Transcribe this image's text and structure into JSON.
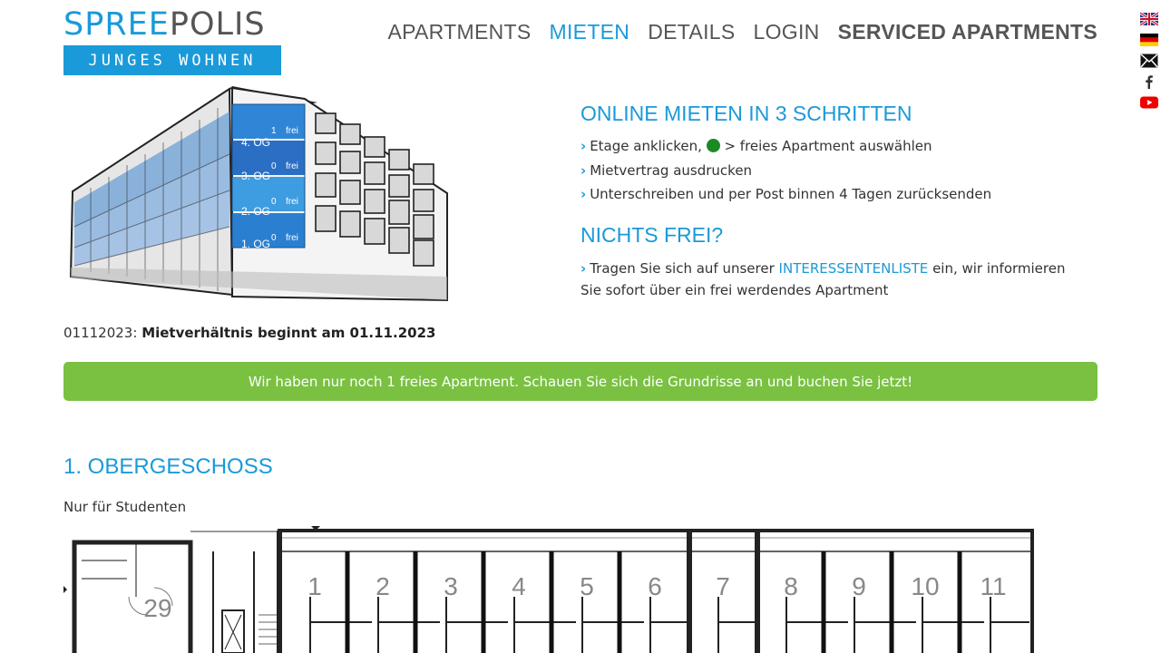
{
  "logo": {
    "word_a": "SPREE",
    "word_b": "POLIS",
    "tagline": "JUNGES WOHNEN"
  },
  "nav": [
    {
      "label": "APARTMENTS",
      "active": false,
      "bold": false
    },
    {
      "label": "MIETEN",
      "active": true,
      "bold": false
    },
    {
      "label": "DETAILS",
      "active": false,
      "bold": false
    },
    {
      "label": "LOGIN",
      "active": false,
      "bold": false
    },
    {
      "label": "SERVICED APARTMENTS",
      "active": false,
      "bold": true
    }
  ],
  "side_icons": [
    "flag-uk-icon",
    "flag-de-icon",
    "mail-icon",
    "facebook-icon",
    "youtube-icon"
  ],
  "building": {
    "floors": [
      {
        "label": "4. OG",
        "free": "1",
        "word": "frei"
      },
      {
        "label": "3. OG",
        "free": "0",
        "word": "frei"
      },
      {
        "label": "2. OG",
        "free": "0",
        "word": "frei"
      },
      {
        "label": "1. OG",
        "free": "0",
        "word": "frei"
      }
    ]
  },
  "steps": {
    "title": "ONLINE MIETEN IN 3 SCHRITTEN",
    "step1_a": "Etage anklicken,",
    "step1_b": "> freies Apartment auswählen",
    "step2": "Mietvertrag ausdrucken",
    "step3": "Unterschreiben und per Post binnen 4 Tagen zurücksenden",
    "nothing_title": "NICHTS FREI?",
    "interest_a": "Tragen Sie sich auf unserer",
    "interest_link": "INTERESSENTENLISTE",
    "interest_b": "ein, wir informieren Sie sofort über ein frei werdendes Apartment"
  },
  "notice": {
    "code": "01112023:",
    "text": "Mietverhältnis beginnt am 01.11.2023"
  },
  "banner": "Wir haben nur noch 1 freies Apartment. Schauen Sie sich die Grundrisse an und buchen Sie jetzt!",
  "floor": {
    "title": "1. OBERGESCHOSS",
    "subtitle": "Nur für Studenten",
    "units": [
      "1",
      "2",
      "3",
      "4",
      "5",
      "6",
      "7",
      "8",
      "9",
      "10",
      "11"
    ],
    "corner_unit": "29"
  },
  "colors": {
    "accent": "#1a9ad9",
    "banner": "#7ac142",
    "available_dot": "#1a8a24"
  }
}
